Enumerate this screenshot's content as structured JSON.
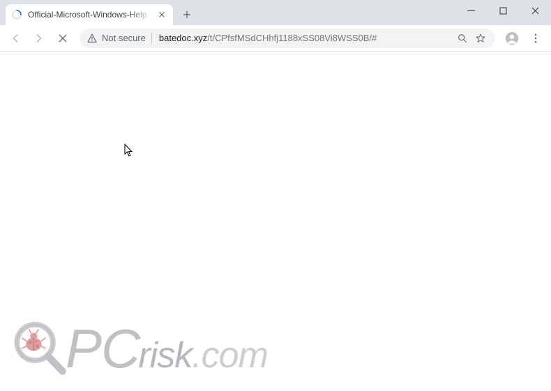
{
  "window": {
    "minimize": "—",
    "maximize": "☐",
    "close": "✕"
  },
  "tab": {
    "title": "Official-Microsoft-Windows-Help"
  },
  "omnibox": {
    "security_label": "Not secure",
    "url_host": "batedoc.xyz",
    "url_path": "/t/CPfsfMSdCHhfj1188xSS08Vi8WSS0B/#"
  },
  "watermark": {
    "pc": "PC",
    "risk": "risk",
    "com": ".com"
  }
}
